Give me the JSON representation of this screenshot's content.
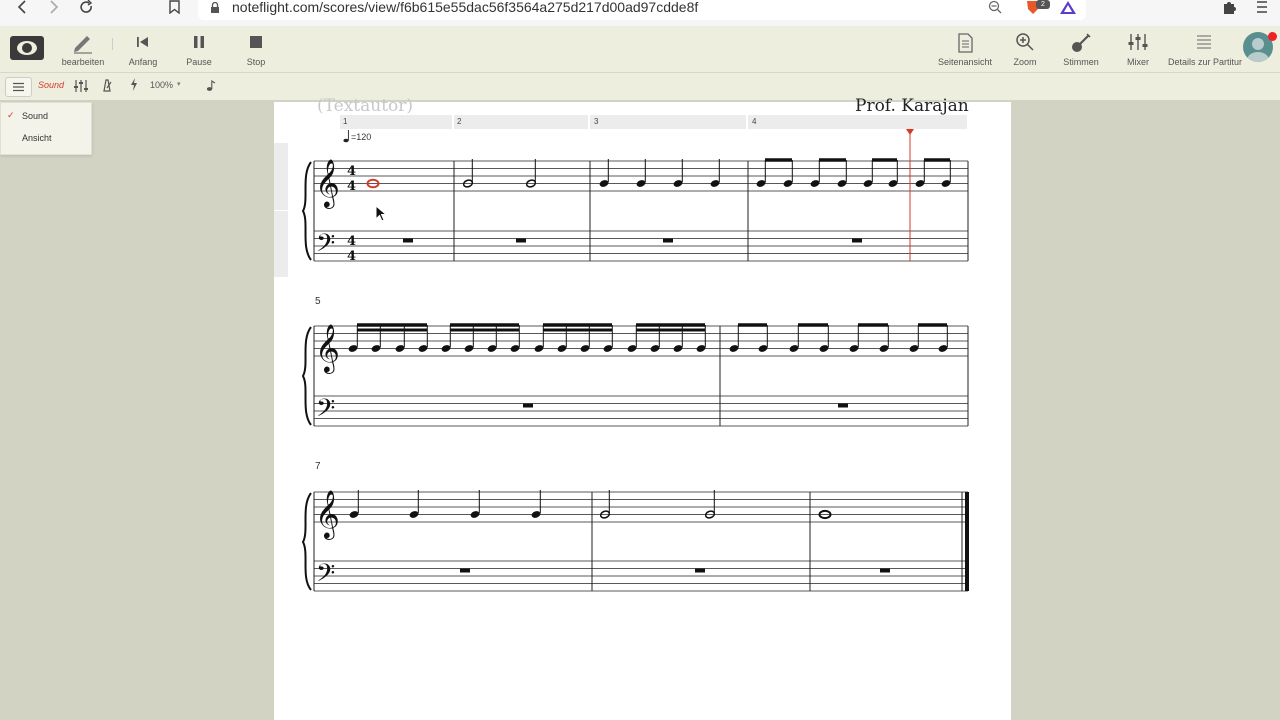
{
  "browser": {
    "url": "noteflight.com/scores/view/f6b615e55dac56f3564a275d217d00ad97cdde8f",
    "extension_badge": "2"
  },
  "toolbar": {
    "edit_label": "bearbeiten",
    "start_label": "Anfang",
    "pause_label": "Pause",
    "stop_label": "Stop",
    "page_view_label": "Seitenansicht",
    "zoom_label": "Zoom",
    "voices_label": "Stimmen",
    "mixer_label": "Mixer",
    "details_label": "Details zur Partitur"
  },
  "subtoolbar": {
    "sound_label": "Sound",
    "zoom_value": "100%"
  },
  "dropdown": {
    "items": [
      {
        "label": "Sound",
        "checked": true
      },
      {
        "label": "Ansicht",
        "checked": false
      }
    ]
  },
  "score": {
    "composer_placeholder": "(Textautor)",
    "composer": "Prof. Karajan",
    "measure_numbers": [
      "1",
      "2",
      "3",
      "4"
    ],
    "tempo": "=120",
    "system_numbers": [
      "5",
      "7"
    ],
    "time_signature": [
      "4",
      "4"
    ]
  },
  "colors": {
    "accent": "#d23a2a",
    "toolbar_bg": "#eeeedf",
    "page_bg": "#d3d3c4"
  }
}
